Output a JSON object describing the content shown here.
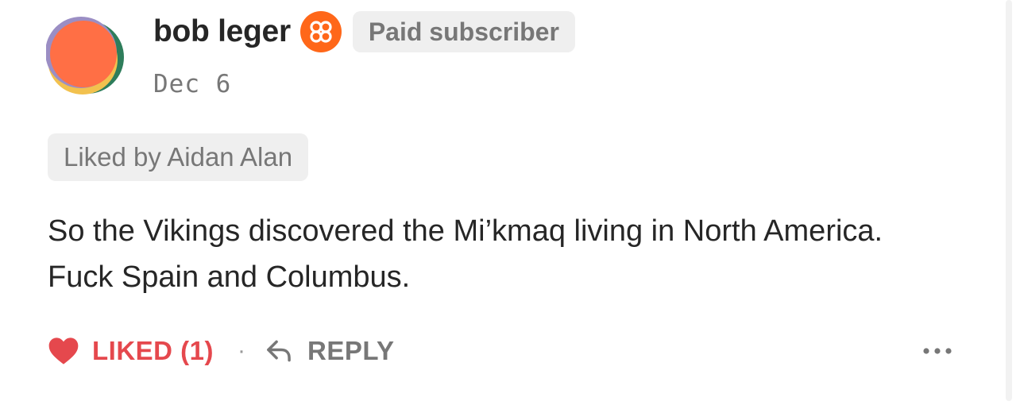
{
  "comment": {
    "author": {
      "name": "bob leger",
      "badge": "Paid subscriber",
      "founder_badge_icon": "founding-member-icon",
      "avatar_icon": "avatar-icon"
    },
    "date": "Dec 6",
    "liked_by": "Liked by Aidan Alan",
    "body": "So the Vikings discovered the Mi’kmaq living in North America. Fuck Spain and Columbus.",
    "actions": {
      "like_label": "LIKED (1)",
      "like_icon": "heart-icon",
      "separator": "·",
      "reply_label": "REPLY",
      "reply_icon": "reply-arrow-icon",
      "more_icon": "more-options-icon"
    }
  },
  "colors": {
    "liked": "#e5484d",
    "founder_badge": "#ff6719",
    "muted_text": "#777777",
    "primary_text": "#262626",
    "badge_bg": "#efefef"
  }
}
